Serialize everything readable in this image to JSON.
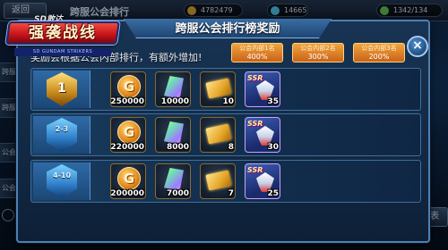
{
  "background": {
    "back_label": "返回",
    "screen_title": "跨服公会排行",
    "resources": [
      "4782479",
      "14665",
      "1342/134"
    ],
    "side_tabs": [
      "跨服",
      "跨服",
      "公会",
      "公会"
    ],
    "bottom_button": "奖励列表"
  },
  "logo": {
    "top": "SD敢达",
    "main": "强袭战线",
    "sub": "SD GUNDAM STRIKERS"
  },
  "modal": {
    "title": "跨服公会排行榜奖励",
    "close_label": "×",
    "description": "奖励会根据公会内部排行，有额外增加!",
    "bonuses": [
      {
        "label": "公会内部1名",
        "value": "400%"
      },
      {
        "label": "公会内部2名",
        "value": "300%"
      },
      {
        "label": "公会内部3名",
        "value": "200%"
      }
    ],
    "rows": [
      {
        "rank": "1",
        "rewards": [
          {
            "icon": "gold-coin-icon",
            "qty": "250000"
          },
          {
            "icon": "crystal-icon",
            "qty": "10000"
          },
          {
            "icon": "gold-ticket-icon",
            "qty": "10"
          },
          {
            "icon": "ssr-mecha-card-icon",
            "tag": "SSR",
            "qty": "35"
          }
        ]
      },
      {
        "rank": "2-3",
        "rewards": [
          {
            "icon": "gold-coin-icon",
            "qty": "220000"
          },
          {
            "icon": "crystal-icon",
            "qty": "8000"
          },
          {
            "icon": "gold-ticket-icon",
            "qty": "8"
          },
          {
            "icon": "ssr-mecha-card-icon",
            "tag": "SSR",
            "qty": "30"
          }
        ]
      },
      {
        "rank": "4-10",
        "rewards": [
          {
            "icon": "gold-coin-icon",
            "qty": "200000"
          },
          {
            "icon": "crystal-icon",
            "qty": "7000"
          },
          {
            "icon": "gold-ticket-icon",
            "qty": "7"
          },
          {
            "icon": "ssr-mecha-card-icon",
            "tag": "SSR",
            "qty": "25"
          }
        ]
      }
    ],
    "coin_glyph": "G"
  }
}
